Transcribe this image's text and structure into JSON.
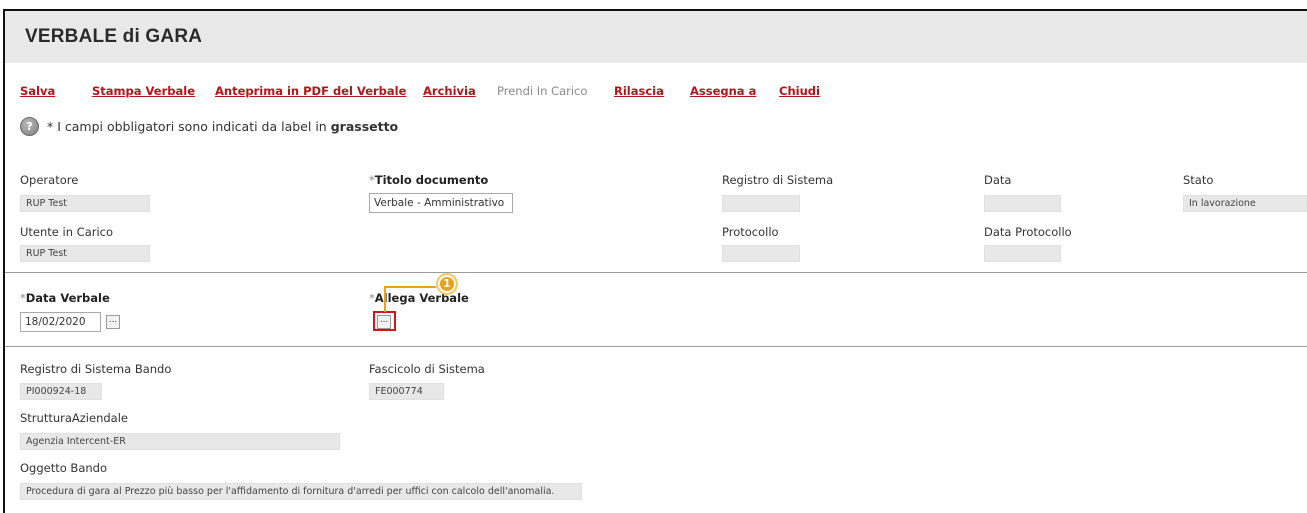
{
  "header": {
    "title": "VERBALE di GARA"
  },
  "toolbar": {
    "salva": "Salva",
    "stampa_verbale": "Stampa Verbale",
    "anteprima_pdf": "Anteprima in PDF del Verbale",
    "archivia": "Archivia",
    "prendi_in_carico": "Prendi In Carico",
    "rilascia": "Rilascia",
    "assegna_a": "Assegna a",
    "chiudi": "Chiudi"
  },
  "note": {
    "text_prefix": "* I campi obbligatori sono indicati da label in ",
    "text_bold": "grassetto",
    "icon": "help-icon"
  },
  "fields": {
    "operatore": {
      "label": "Operatore",
      "value": "RUP Test"
    },
    "titolo_documento": {
      "label": "Titolo documento",
      "required_mark": "*",
      "value": "Verbale - Amministrativo"
    },
    "registro_sistema": {
      "label": "Registro di Sistema",
      "value": ""
    },
    "data": {
      "label": "Data",
      "value": ""
    },
    "stato": {
      "label": "Stato",
      "value": "In lavorazione"
    },
    "utente_in_carico": {
      "label": "Utente in Carico",
      "value": "RUP Test"
    },
    "protocollo": {
      "label": "Protocollo",
      "value": ""
    },
    "data_protocollo": {
      "label": "Data Protocollo",
      "value": ""
    },
    "data_verbale": {
      "label": "Data Verbale",
      "required_mark": "*",
      "value": "18/02/2020",
      "button": "..."
    },
    "allega_verbale": {
      "label": "Allega Verbale",
      "required_mark": "*",
      "button": "..."
    },
    "registro_sistema_bando": {
      "label": "Registro di Sistema Bando",
      "value": "PI000924-18"
    },
    "fascicolo_sistema": {
      "label": "Fascicolo di Sistema",
      "value": "FE000774"
    },
    "struttura_aziendale": {
      "label": "StrutturaAziendale",
      "value": "Agenzia Intercent-ER"
    },
    "oggetto_bando": {
      "label": "Oggetto Bando",
      "value": "Procedura di gara al Prezzo più basso per l'affidamento di fornitura d'arredi per uffici con calcolo dell'anomalia."
    }
  },
  "annotation": {
    "callout_number": "1",
    "color": "#e8a21d",
    "highlight_color": "#d2161c"
  }
}
